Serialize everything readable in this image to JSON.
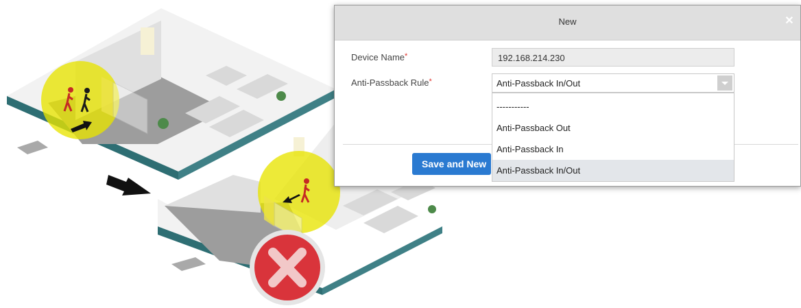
{
  "dialog": {
    "title": "New",
    "close_icon": "close-icon",
    "fields": {
      "device_name_label": "Device Name",
      "device_name_value": "192.168.214.230",
      "anti_passback_label": "Anti-Passback Rule",
      "anti_passback_value": "Anti-Passback In/Out",
      "required_mark": "*"
    },
    "dropdown_options": [
      "-----------",
      "Anti-Passback Out",
      "Anti-Passback In",
      "Anti-Passback In/Out"
    ],
    "save_button": "Save and New"
  },
  "illustration": {
    "icons": [
      "walking-person-icon",
      "arrow-icon",
      "denied-x-icon"
    ],
    "colors": {
      "zone_yellow": "#e8e400",
      "floor_gray": "#9d9d9d",
      "wall_teal": "#2e6e73",
      "denied_red": "#d9343b"
    }
  }
}
